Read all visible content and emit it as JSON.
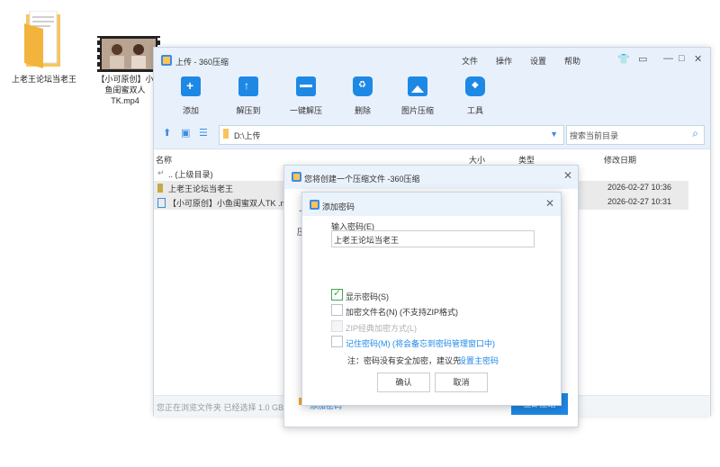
{
  "desktop": {
    "folder_label": "上老王论坛当老王",
    "video_label": "【小可原创】小鱼闺蜜双人TK.mp4"
  },
  "window": {
    "title": "上传 - 360压缩",
    "menu": [
      "文件",
      "操作",
      "设置",
      "帮助"
    ],
    "toolbar": {
      "add": "添加",
      "extract_to": "解压到",
      "one_click_extract": "一键解压",
      "delete": "删除",
      "image_compress": "图片压缩",
      "tools": "工具"
    },
    "path": "D:\\上传",
    "search_placeholder": "搜索当前目录",
    "columns": {
      "name": "名称",
      "size": "大小",
      "type": "类型",
      "modified": "修改日期"
    },
    "rows": [
      {
        "name": ".. (上级目录)",
        "modified": ""
      },
      {
        "name": "上老王论坛当老王",
        "modified": "2026-02-27 10:36"
      },
      {
        "name": "【小可原创】小鱼闺蜜双人TK .m",
        "modified": "2026-02-27 10:31"
      }
    ],
    "status": "您正在浏览文件夹 已经选择 1.0 GB ("
  },
  "dialog_create": {
    "title": "您将创建一个压缩文件 -360压缩",
    "field_prefix_1": "上",
    "field_prefix_2": "压",
    "add_password_link": "添加密码",
    "compress_button": "立即压缩"
  },
  "dialog_password": {
    "title": "添加密码",
    "input_label": "输入密码(E)",
    "password_value": "上老王论坛当老王",
    "options": {
      "show_password": "显示密码(S)",
      "encrypt_names": "加密文件名(N) (不支持ZIP格式)",
      "zip_classic": "ZIP经典加密方式(L)",
      "remember": "记住密码(M) (将会备忘到密码管理窗口中)"
    },
    "note_prefix": "注：密码没有安全加密，建议先",
    "note_link": "设置主密码",
    "ok": "确认",
    "cancel": "取消"
  },
  "colors": {
    "accent": "#1e88e5",
    "titlebar_bg": "#e8f1fb",
    "check": "#41a84c"
  }
}
